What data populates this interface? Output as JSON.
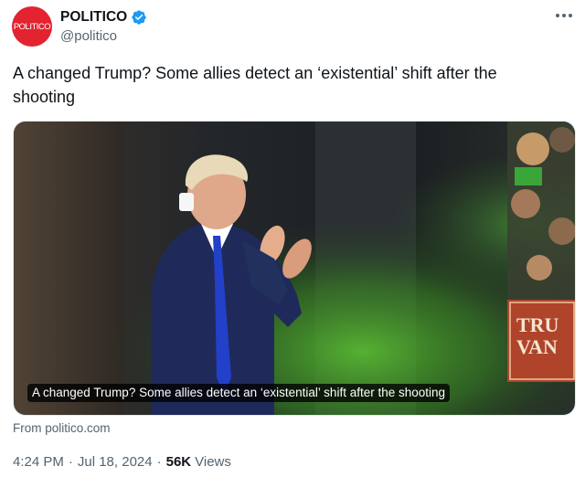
{
  "account": {
    "avatar_text": "POLITICO",
    "display_name": "POLITICO",
    "handle": "@politico",
    "verified": true,
    "brand_color": "#e3232f",
    "verified_color": "#1d9bf0"
  },
  "tweet": {
    "text": "A changed Trump? Some allies detect an ‘existential’ shift after the shooting"
  },
  "card": {
    "caption": "A changed Trump? Some allies detect an ‘existential’ shift after the shooting",
    "source": "From politico.com",
    "sign_text_line1": "TRU",
    "sign_text_line2": "VAN"
  },
  "meta": {
    "time": "4:24 PM",
    "separator": "·",
    "date": "Jul 18, 2024",
    "views_count": "56K",
    "views_label": "Views"
  },
  "icons": {
    "verified": "verified-badge-icon",
    "more": "more-horizontal-icon"
  }
}
